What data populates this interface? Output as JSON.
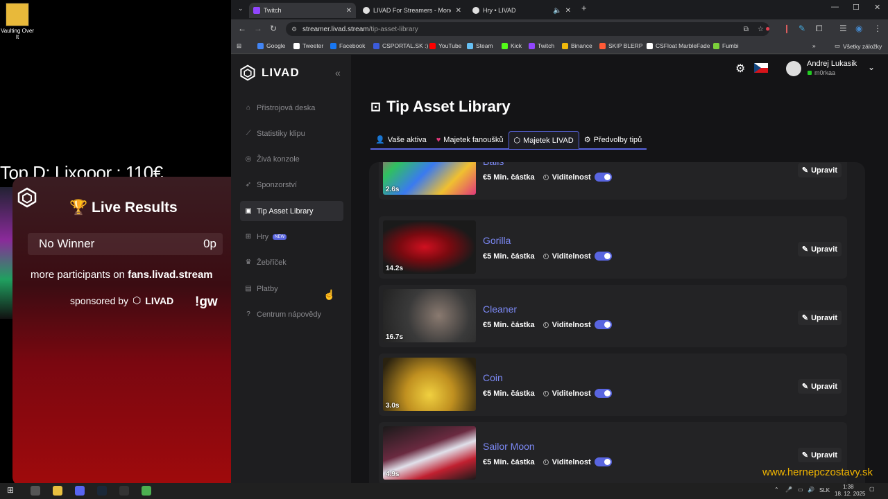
{
  "desktop": {
    "icon_label": "Vaulting Over It"
  },
  "overlay": {
    "title": "Top D: Lixooor : 110€"
  },
  "widget": {
    "header": "Live Results",
    "winner_name": "No Winner",
    "winner_points": "0p",
    "more_text_prefix": "more participants on ",
    "more_text_site": "fans.livad.stream",
    "sponsored": "sponsored by",
    "sponsor_brand": "LIVAD",
    "command": "!gw"
  },
  "browser": {
    "tabs": [
      {
        "label": "Twitch",
        "color": "#9146ff"
      },
      {
        "label": "LIVAD For Streamers - Monetiz",
        "color": "#e0e0e0"
      },
      {
        "label": "Hry • LIVAD",
        "color": "#e0e0e0"
      }
    ],
    "url_host": "streamer.livad.stream",
    "url_path": "/tip-asset-library",
    "bookmarks": [
      {
        "label": "Google",
        "color": "#4285f4"
      },
      {
        "label": "Tweeter",
        "color": "#ffffff"
      },
      {
        "label": "Facebook",
        "color": "#1877f2"
      },
      {
        "label": "CSPORTAL.SK :)",
        "color": "#3b5bdb"
      },
      {
        "label": "YouTube",
        "color": "#ff0000"
      },
      {
        "label": "Steam",
        "color": "#66c0f4"
      },
      {
        "label": "Kick",
        "color": "#53fc18"
      },
      {
        "label": "Twitch",
        "color": "#9146ff"
      },
      {
        "label": "Binance",
        "color": "#f0b90b"
      },
      {
        "label": "SKIP BLERP",
        "color": "#ff5a36"
      },
      {
        "label": "CSFloat MarbleFade",
        "color": "#ffffff"
      },
      {
        "label": "Fumbi",
        "color": "#7bd13a"
      }
    ],
    "all_bookmarks": "Všetky záložky"
  },
  "app": {
    "brand": "LIVAD",
    "nav": [
      {
        "label": "Přistrojová deska",
        "icon": "home-icon",
        "glyph": "⌂"
      },
      {
        "label": "Statistiky klipu",
        "icon": "chart-icon",
        "glyph": "⟋"
      },
      {
        "label": "Živá konzole",
        "icon": "live-icon",
        "glyph": "◎"
      },
      {
        "label": "Sponzorství",
        "icon": "rocket-icon",
        "glyph": "➶"
      },
      {
        "label": "Tip Asset Library",
        "icon": "library-icon",
        "glyph": "▣"
      },
      {
        "label": "Hry",
        "icon": "gamepad-icon",
        "glyph": "⊞",
        "badge": "NEW"
      },
      {
        "label": "Žebříček",
        "icon": "trophy-icon",
        "glyph": "♛"
      },
      {
        "label": "Platby",
        "icon": "wallet-icon",
        "glyph": "▤"
      },
      {
        "label": "Centrum nápovědy",
        "icon": "help-icon",
        "glyph": "?"
      }
    ],
    "user_name": "Andrej Lukasik",
    "user_handle": "m0rkaa",
    "page_title": "Tip Asset Library",
    "tabs": [
      {
        "label": "Vaše aktiva",
        "icon": "👤"
      },
      {
        "label": "Majetek fanoušků",
        "icon": "♥"
      },
      {
        "label": "Majetek LIVAD",
        "icon": "⬡"
      },
      {
        "label": "Předvolby tipů",
        "icon": "⚙"
      }
    ],
    "cards": [
      {
        "name": "Balls",
        "duration": "2.6s",
        "amount": "€5 Min. částka",
        "visibility": "Viditelnost",
        "edit": "Upravit",
        "bg": "linear-gradient(135deg,#e0387a,#30c060,#3a7af0,#f0c030,#e0387a)"
      },
      {
        "name": "Gorilla",
        "duration": "14.2s",
        "amount": "€5 Min. částka",
        "visibility": "Viditelnost",
        "edit": "Upravit",
        "bg": "radial-gradient(ellipse at 45% 50%,#d01020 0%,#7a0a10 35%,#1a1a1a 70%)"
      },
      {
        "name": "Cleaner",
        "duration": "16.7s",
        "amount": "€5 Min. částka",
        "visibility": "Viditelnost",
        "edit": "Upravit",
        "bg": "radial-gradient(circle at 60% 50%,#8a7a70 0%,#3a3a3a 50%,#222 100%)"
      },
      {
        "name": "Coin",
        "duration": "3.0s",
        "amount": "€5 Min. částka",
        "visibility": "Viditelnost",
        "edit": "Upravit",
        "bg": "radial-gradient(circle at 50% 70%,#f0d040 0%,#c09020 40%,#2a2210 90%)"
      },
      {
        "name": "Sailor Moon",
        "duration": "4.9s",
        "amount": "€5 Min. částka",
        "visibility": "Viditelnost",
        "edit": "Upravit",
        "bg": "linear-gradient(160deg,#1a1a1a 0%,#6a2a40 40%,#e0e0ea 55%,#c02030 75%,#1a1a1a 100%)"
      }
    ]
  },
  "taskbar": {
    "lang": "SLK",
    "time": "1:38",
    "date": "18. 12. 2025"
  },
  "watermark": "www.hernepczostavy.sk"
}
